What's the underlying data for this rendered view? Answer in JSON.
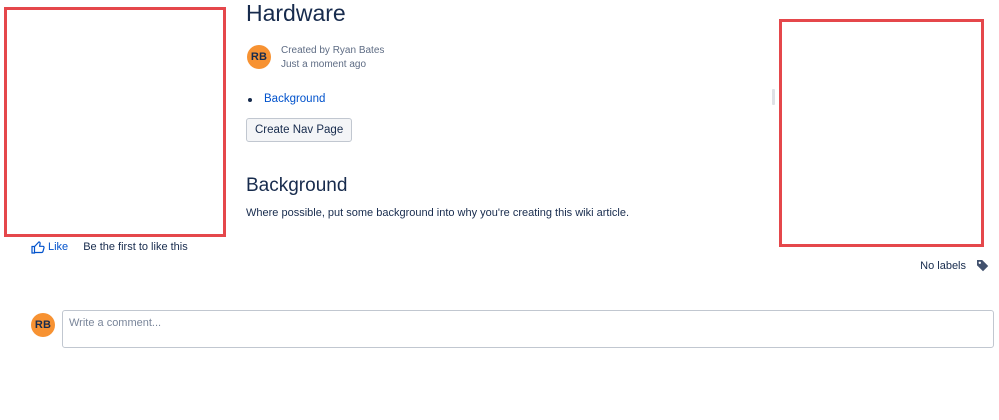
{
  "page": {
    "title": "Hardware",
    "author": {
      "initials": "RB",
      "created_by": "Created by Ryan Bates",
      "time": "Just a moment ago",
      "avatar_color": "#f79232"
    },
    "toc": [
      {
        "label": "Background"
      }
    ],
    "create_nav_button": "Create Nav Page",
    "sections": [
      {
        "heading": "Background",
        "body": "Where possible, put some background into why you're creating this wiki article."
      }
    ]
  },
  "footer": {
    "like_label": "Like",
    "like_message": "Be the first to like this",
    "labels_text": "No labels",
    "icons": {
      "like": "thumbs-up-icon",
      "labels": "tag-icon"
    }
  },
  "comment": {
    "initials": "RB",
    "placeholder": "Write a comment..."
  },
  "annotations": {
    "redaction_color": "#e5474b"
  }
}
